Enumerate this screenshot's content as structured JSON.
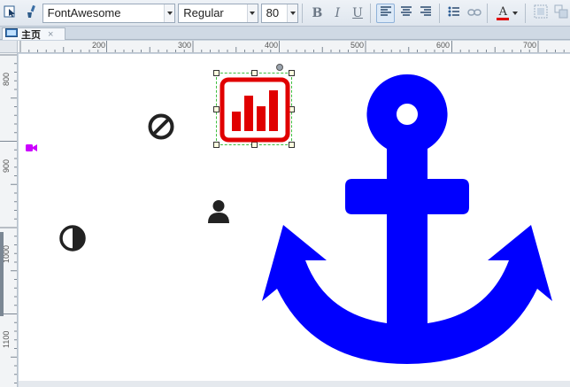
{
  "toolbar": {
    "font_family": "FontAwesome",
    "font_style": "Regular",
    "font_size": "80",
    "bold_label": "B",
    "italic_label": "I",
    "underline_label": "U",
    "font_color_label": "A",
    "font_color": "#e00000"
  },
  "tab": {
    "title": "主页",
    "close": "×"
  },
  "rulers": {
    "top": [
      "200",
      "300",
      "400",
      "500",
      "600",
      "700"
    ],
    "left": [
      "800",
      "900",
      "1000",
      "1100"
    ]
  },
  "canvas": {
    "icons": {
      "ban": "ban-icon",
      "chart": "bar-chart-icon",
      "user": "user-icon",
      "half_circle": "adjust-icon",
      "video": "video-camera-icon",
      "anchor": "anchor-icon"
    },
    "colors": {
      "anchor": "#0000ff",
      "chart": "#e00000",
      "video": "#cc00ff",
      "dark": "#222222"
    }
  }
}
